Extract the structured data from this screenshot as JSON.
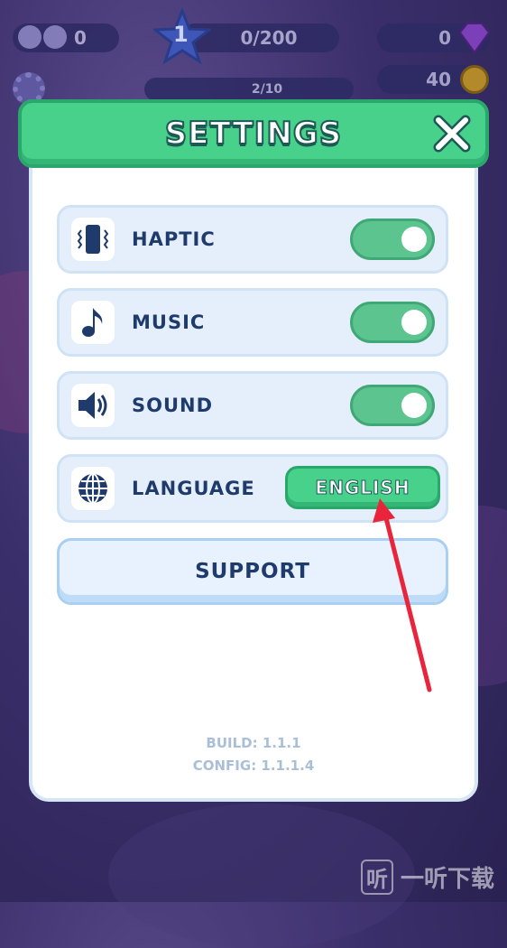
{
  "hud": {
    "left_count": "0",
    "level": "1",
    "progress": "0/200",
    "gems": "0",
    "coins": "40",
    "sub_progress": "2/10"
  },
  "settings": {
    "title": "SETTINGS",
    "rows": [
      {
        "label": "HAPTIC",
        "icon": "vibration-icon",
        "enabled": true
      },
      {
        "label": "MUSIC",
        "icon": "music-note-icon",
        "enabled": true
      },
      {
        "label": "SOUND",
        "icon": "speaker-icon",
        "enabled": true
      }
    ],
    "language": {
      "label": "LANGUAGE",
      "icon": "globe-icon",
      "value": "ENGLISH"
    },
    "support_label": "SUPPORT",
    "build": "BUILD: 1.1.1",
    "config": "CONFIG: 1.1.1.4"
  },
  "watermark": {
    "text": "一听下载",
    "icon": "听"
  },
  "colors": {
    "header_green": "#48d18b",
    "toggle_green": "#5bc48f",
    "label_navy": "#1f3b6b",
    "annotation_arrow": "#e8253a"
  }
}
